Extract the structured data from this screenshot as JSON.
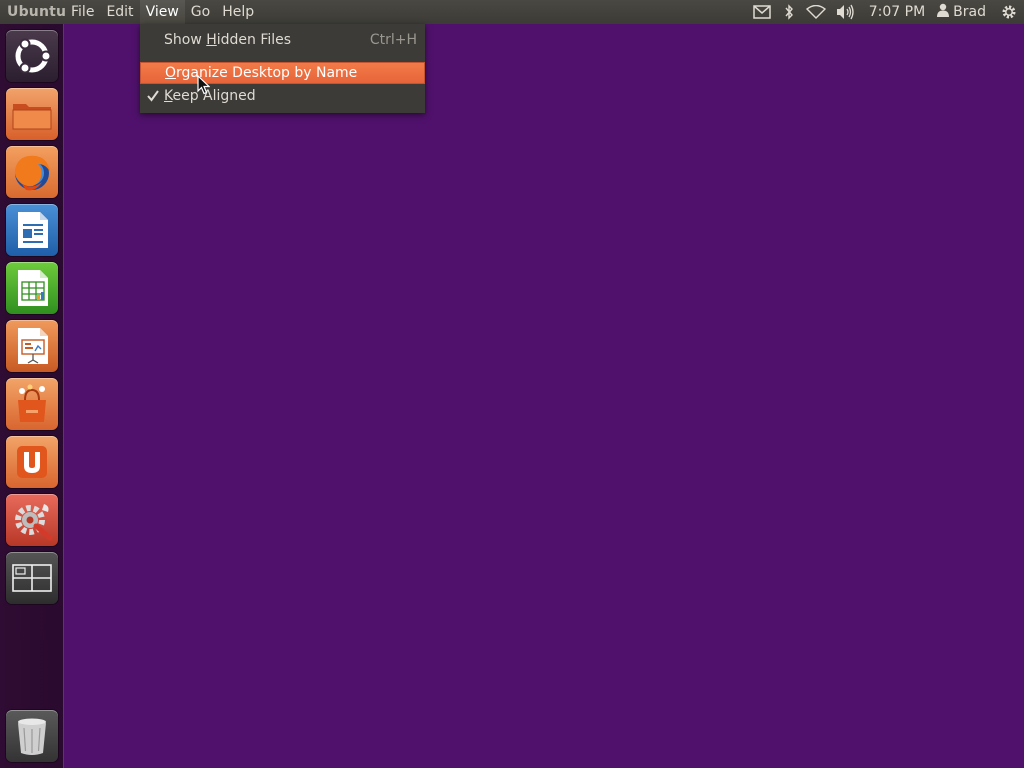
{
  "top_panel": {
    "app_title": "Ubuntu",
    "menus": [
      {
        "label": "File"
      },
      {
        "label": "Edit"
      },
      {
        "label": "View"
      },
      {
        "label": "Go"
      },
      {
        "label": "Help"
      }
    ],
    "indicators": {
      "mail_icon": "mail-icon",
      "bluetooth_icon": "bluetooth-icon",
      "network_icon": "wifi-icon",
      "sound_icon": "volume-icon",
      "clock": "7:07 PM",
      "user_name": "Brad",
      "session_icon": "gear-icon"
    }
  },
  "view_menu": {
    "items": [
      {
        "pre": "Show ",
        "mnemonic": "H",
        "post": "idden Files",
        "accel": "Ctrl+H"
      },
      {
        "pre": "",
        "mnemonic": "O",
        "post": "rganize Desktop by Name",
        "accel": ""
      },
      {
        "pre": "",
        "mnemonic": "K",
        "post": "eep Aligned",
        "accel": "",
        "checked": true
      }
    ]
  },
  "launcher": {
    "items": [
      {
        "name": "dash-home-icon"
      },
      {
        "name": "home-folder-icon"
      },
      {
        "name": "firefox-icon"
      },
      {
        "name": "libreoffice-writer-icon"
      },
      {
        "name": "libreoffice-calc-icon"
      },
      {
        "name": "libreoffice-impress-icon"
      },
      {
        "name": "software-center-icon"
      },
      {
        "name": "ubuntu-one-icon"
      },
      {
        "name": "system-settings-icon"
      },
      {
        "name": "workspace-switcher-icon"
      },
      {
        "name": "trash-icon"
      }
    ]
  },
  "colors": {
    "desktop": "#4f116b",
    "highlight": "#f07746",
    "panel": "#3c3b37"
  }
}
